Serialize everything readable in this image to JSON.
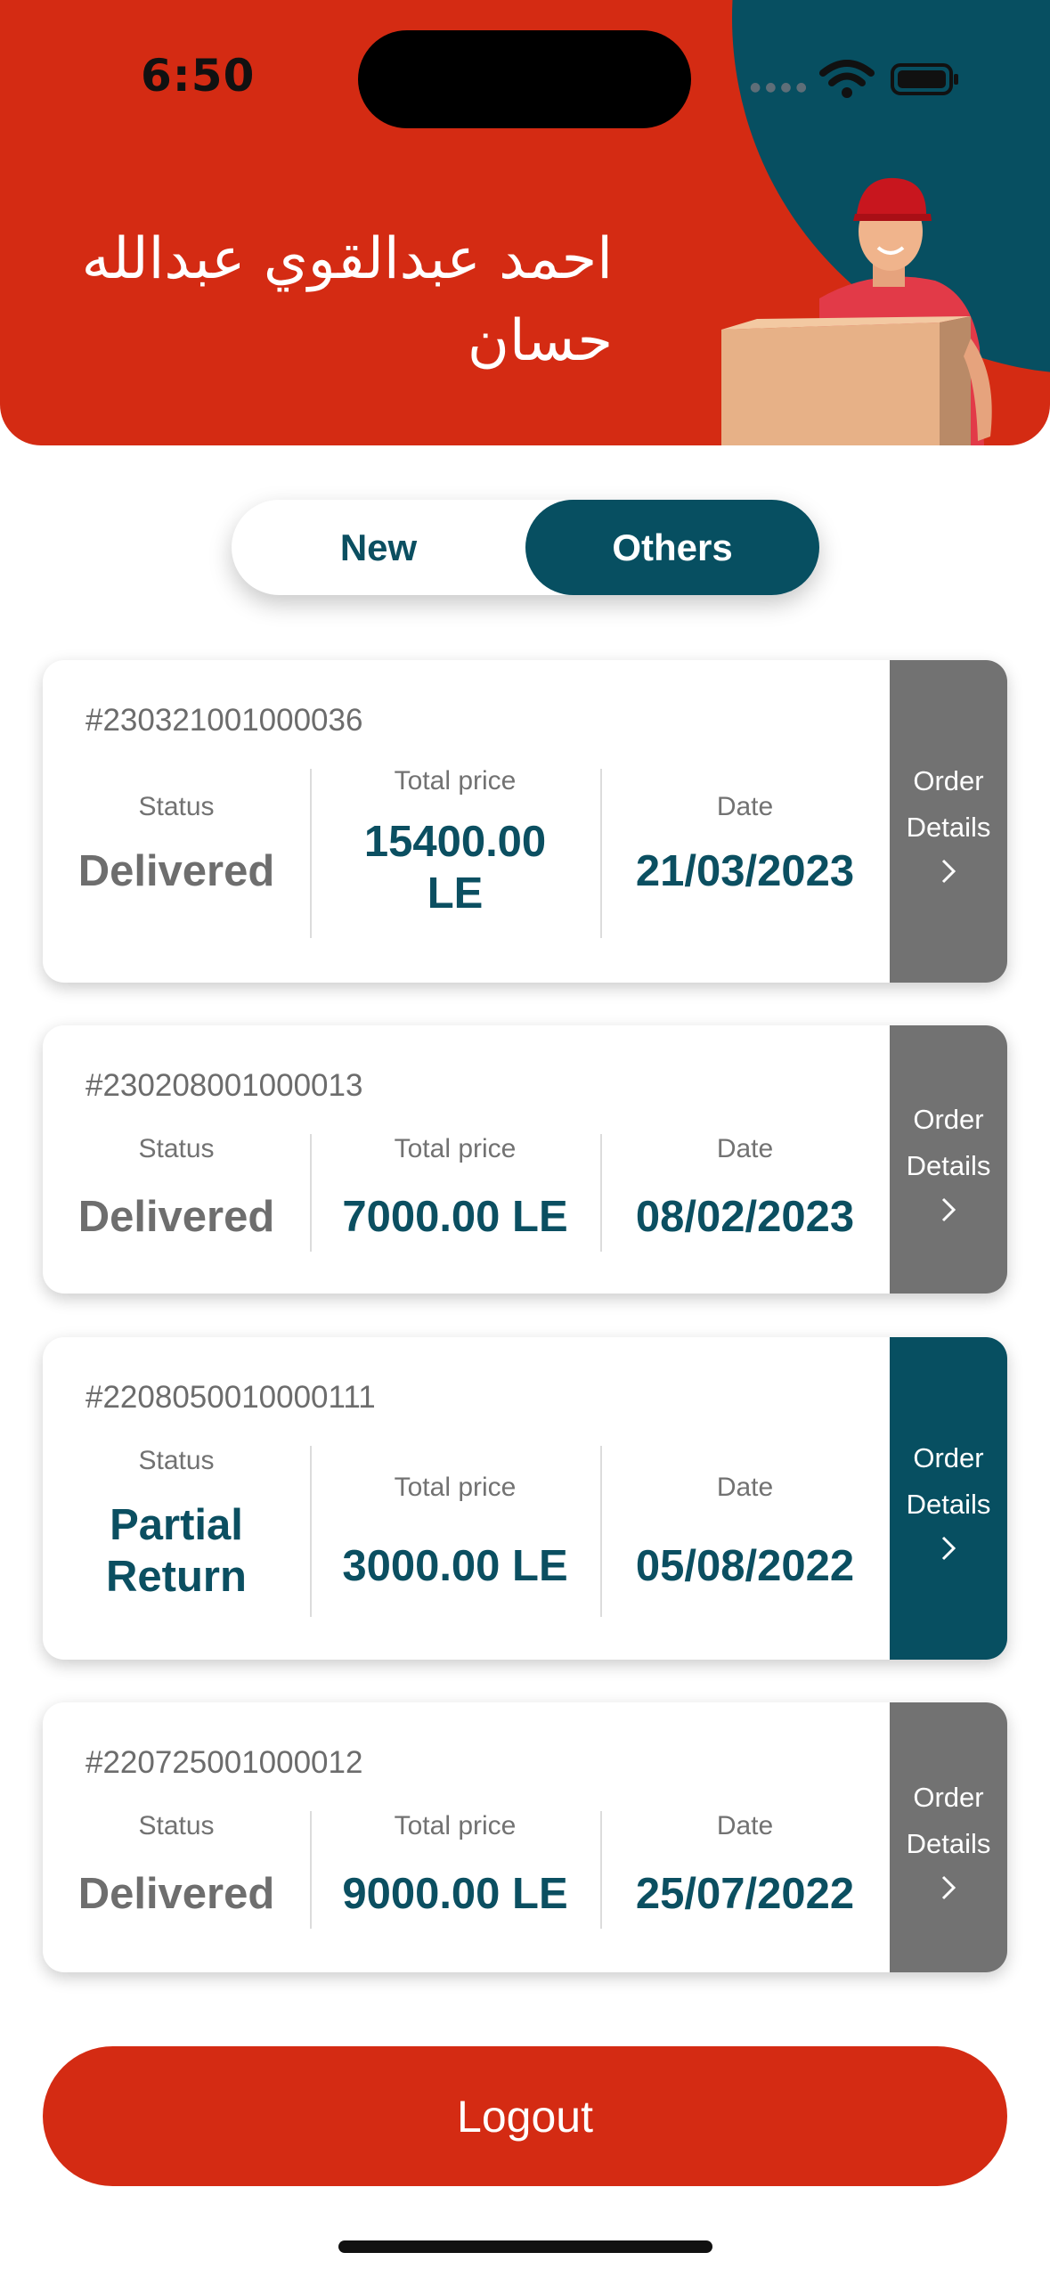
{
  "status_bar": {
    "time": "6:50"
  },
  "header": {
    "name_line1": "احمد عبدالقوي عبدالله",
    "name_line2": "حسان"
  },
  "tabs": [
    {
      "label": "New",
      "active": false
    },
    {
      "label": "Others",
      "active": true
    }
  ],
  "columns": {
    "status": "Status",
    "total": "Total price",
    "date": "Date"
  },
  "details_label": {
    "line1": "Order",
    "line2": "Details"
  },
  "orders": [
    {
      "id": "#230321001000036",
      "status": "Delivered",
      "total": "15400.00 LE",
      "date": "21/03/2023"
    },
    {
      "id": "#230208001000013",
      "status": "Delivered",
      "total": "7000.00 LE",
      "date": "08/02/2023"
    },
    {
      "id": "#2208050010000111",
      "status": "Partial Return",
      "total": "3000.00 LE",
      "date": "05/08/2022"
    },
    {
      "id": "#220725001000012",
      "status": "Delivered",
      "total": "9000.00 LE",
      "date": "25/07/2022"
    }
  ],
  "logout_label": "Logout",
  "colors": {
    "brand_red": "#d42b13",
    "brand_teal": "#074f61",
    "gray": "#727272"
  }
}
